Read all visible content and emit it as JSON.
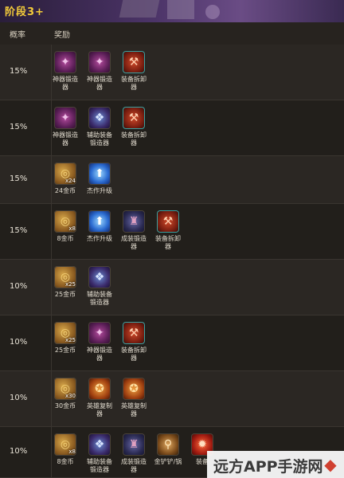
{
  "header": {
    "title": "阶段3+"
  },
  "table": {
    "col_prob": "概率",
    "col_reward": "奖励",
    "rows": [
      {
        "prob": "15%",
        "items": [
          {
            "icon": "artifact-forge-icon",
            "qty": "",
            "label": "神器锻造器"
          },
          {
            "icon": "artifact-forge-icon",
            "qty": "",
            "label": "神器锻造器"
          },
          {
            "icon": "item-dismantler-icon",
            "qty": "",
            "label": "装备拆卸器"
          }
        ]
      },
      {
        "prob": "15%",
        "items": [
          {
            "icon": "artifact-forge-icon",
            "qty": "",
            "label": "神器锻造器"
          },
          {
            "icon": "support-item-forge-icon",
            "qty": "",
            "label": "辅助装备锻造器"
          },
          {
            "icon": "item-dismantler-icon",
            "qty": "",
            "label": "装备拆卸器"
          }
        ]
      },
      {
        "prob": "15%",
        "items": [
          {
            "icon": "gold-coin-icon",
            "qty": "x24",
            "label": "24金币"
          },
          {
            "icon": "masterwork-upgrade-icon",
            "qty": "",
            "label": "杰作升级"
          }
        ]
      },
      {
        "prob": "15%",
        "items": [
          {
            "icon": "gold-coin-icon",
            "qty": "x8",
            "label": "8金币"
          },
          {
            "icon": "masterwork-upgrade-icon",
            "qty": "",
            "label": "杰作升级"
          },
          {
            "icon": "finished-item-forge-icon",
            "qty": "",
            "label": "成装锻造器"
          },
          {
            "icon": "item-dismantler-icon",
            "qty": "",
            "label": "装备拆卸器"
          }
        ]
      },
      {
        "prob": "10%",
        "items": [
          {
            "icon": "gold-coin-icon",
            "qty": "x25",
            "label": "25金币"
          },
          {
            "icon": "support-item-forge-icon",
            "qty": "",
            "label": "辅助装备锻造器"
          }
        ]
      },
      {
        "prob": "10%",
        "items": [
          {
            "icon": "gold-coin-icon",
            "qty": "x25",
            "label": "25金币"
          },
          {
            "icon": "artifact-forge-icon",
            "qty": "",
            "label": "神器锻造器"
          },
          {
            "icon": "item-dismantler-icon",
            "qty": "",
            "label": "装备拆卸器"
          }
        ]
      },
      {
        "prob": "10%",
        "items": [
          {
            "icon": "gold-coin-icon",
            "qty": "x30",
            "label": "30金币"
          },
          {
            "icon": "hero-duplicator-icon",
            "qty": "",
            "label": "英雄复制器"
          },
          {
            "icon": "hero-duplicator-icon",
            "qty": "",
            "label": "英雄复制器"
          }
        ]
      },
      {
        "prob": "10%",
        "items": [
          {
            "icon": "gold-coin-icon",
            "qty": "x8",
            "label": "8金币"
          },
          {
            "icon": "support-item-forge-icon",
            "qty": "",
            "label": "辅助装备锻造器"
          },
          {
            "icon": "finished-item-forge-icon",
            "qty": "",
            "label": "成装锻造器"
          },
          {
            "icon": "golden-spatula-icon",
            "qty": "",
            "label": "金铲铲/锅"
          },
          {
            "icon": "fire-item-icon",
            "qty": "",
            "label": "装备"
          }
        ]
      }
    ]
  },
  "watermark": {
    "text": "远方APP手游网"
  }
}
